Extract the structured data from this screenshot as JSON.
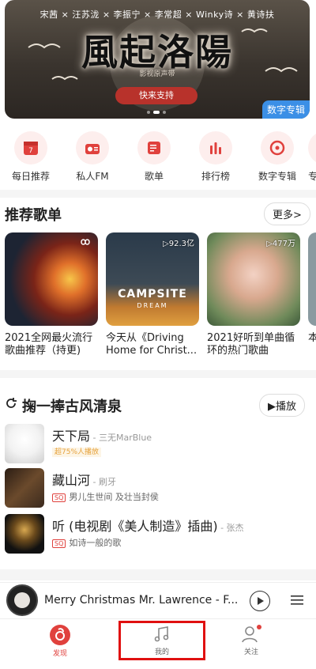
{
  "banner": {
    "credits": "宋茜 × 汪苏泷 × 李振宁 × 李常超 × Winky诗 × 黄诗扶",
    "title": "風起洛陽",
    "subtitle": "影视原声带",
    "support_label": "快来支持",
    "tag": "数字专辑"
  },
  "quick_nav": [
    {
      "label": "每日推荐",
      "icon": "calendar-icon"
    },
    {
      "label": "私人FM",
      "icon": "radio-icon"
    },
    {
      "label": "歌单",
      "icon": "playlist-icon"
    },
    {
      "label": "排行榜",
      "icon": "chart-icon"
    },
    {
      "label": "数字专辑",
      "icon": "album-icon"
    },
    {
      "label": "专",
      "icon": "partial-icon"
    }
  ],
  "recommended": {
    "title": "推荐歌单",
    "more_label": "更多>",
    "playlists": [
      {
        "count": "",
        "text": "2021全网最火流行歌曲推荐（持更)"
      },
      {
        "count": "▷92.3亿",
        "text": "今天从《Driving Home for Christ..."
      },
      {
        "count": "▷477万",
        "text": "2021好听到单曲循环的热门歌曲"
      },
      {
        "count": "",
        "text": "本"
      }
    ]
  },
  "section2": {
    "title": "掬一捧古风清泉",
    "play_label": "▶播放",
    "songs": [
      {
        "name": "天下局",
        "artist": " - 三无MarBlue",
        "badge": "超75%人播放",
        "line": ""
      },
      {
        "name": "藏山河",
        "artist": " - 刷牙",
        "badge": "SQ",
        "line": "男儿生世间 及壮当封侯"
      },
      {
        "name": "听 (电视剧《美人制造》插曲)",
        "artist": " - 张杰",
        "badge": "SQ",
        "line": "如诗一般的歌"
      }
    ]
  },
  "player": {
    "title": "Merry Christmas Mr. Lawrence - F..."
  },
  "tabs": [
    {
      "label": "发现"
    },
    {
      "label": "我的"
    },
    {
      "label": "关注"
    }
  ],
  "colors": {
    "accent": "#e0413d"
  }
}
